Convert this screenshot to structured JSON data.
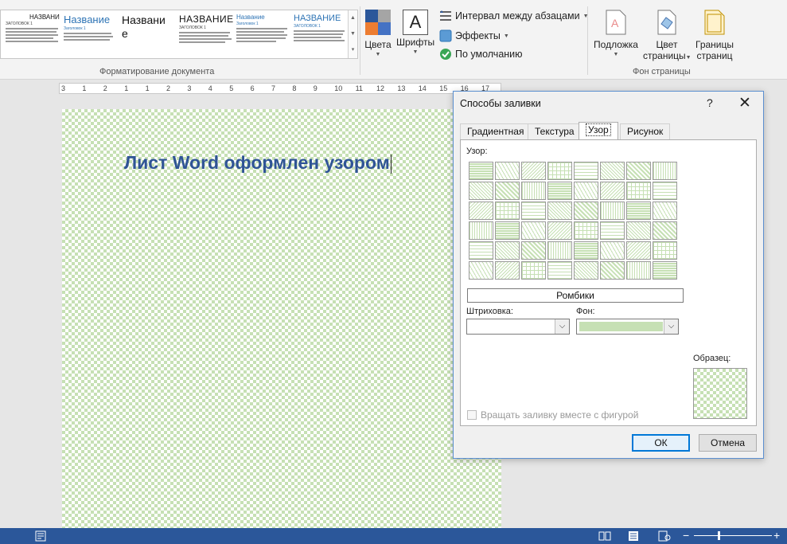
{
  "ribbon": {
    "style_gallery": [
      {
        "heading": "НАЗВАНИЕ",
        "sub": "ЗАГОЛОВОК 1",
        "color": "#111111"
      },
      {
        "heading": "Название",
        "sub": "Заголовок 1",
        "color": "#2e74b5"
      },
      {
        "heading": "Названи е",
        "sub": "",
        "color": "#111111"
      },
      {
        "heading": "НАЗВАНИЕ",
        "sub": "ЗАГОЛОВОК 1",
        "color": "#111111"
      },
      {
        "heading": "Название",
        "sub": "Заголовок 1",
        "color": "#2e74b5"
      },
      {
        "heading": "НАЗВАНИЕ",
        "sub": "ЗАГОЛОВОК 1",
        "color": "#2e74b5"
      }
    ],
    "group_format_label": "Форматирование документа",
    "colors_label": "Цвета",
    "fonts_label": "Шрифты",
    "fonts_glyph": "A",
    "paragraph_spacing_label": "Интервал между абзацами",
    "effects_label": "Эффекты",
    "default_label": "По умолчанию",
    "watermark_label": "Подложка",
    "page_color_label_1": "Цвет",
    "page_color_label_2": "страницы",
    "page_borders_label_1": "Границы",
    "page_borders_label_2": "страниц",
    "group_page_bg_label": "Фон страницы"
  },
  "ruler": {
    "ticks": [
      "3",
      "1",
      "2",
      "1",
      "1",
      "2",
      "3",
      "4",
      "5",
      "6",
      "7",
      "8",
      "9",
      "10",
      "11",
      "12",
      "13",
      "14",
      "15",
      "16",
      "17"
    ]
  },
  "document": {
    "text": "Лист Word оформлен узором"
  },
  "dialog": {
    "title": "Способы заливки",
    "help": "?",
    "close": "✕",
    "tabs": [
      "Градиентная",
      "Текстура",
      "Узор",
      "Рисунок"
    ],
    "active_tab": "Узор",
    "pattern_label": "Узор:",
    "selected_pattern_name": "Ромбики",
    "foreground_label": "Штриховка:",
    "background_label": "Фон:",
    "sample_label": "Образец:",
    "rotate_label": "Вращать заливку вместе с фигурой",
    "rotate_checked": false,
    "ok_label": "ОК",
    "cancel_label": "Отмена",
    "background_color": "#c6e0b4"
  },
  "colors": {
    "pattern_green": "#c6e0b4",
    "heading_blue": "#2f5496",
    "statusbar": "#2b579a"
  }
}
